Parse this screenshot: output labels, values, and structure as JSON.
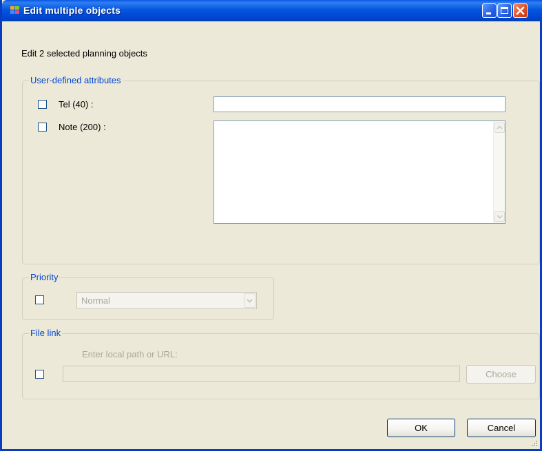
{
  "window": {
    "title": "Edit multiple objects",
    "subtitle": "Edit 2 selected planning objects"
  },
  "user_attributes": {
    "legend": "User-defined attributes",
    "tel_label": "Tel (40) :",
    "tel_value": "",
    "note_label": "Note (200) :",
    "note_value": ""
  },
  "priority": {
    "legend": "Priority",
    "selected": "Normal"
  },
  "file_link": {
    "legend": "File link",
    "hint": "Enter local path or URL:",
    "path_value": "",
    "choose_label": "Choose"
  },
  "buttons": {
    "ok": "OK",
    "cancel": "Cancel"
  },
  "colors": {
    "titlebar": "#0046d5",
    "legend_text": "#0046d5",
    "dialog_bg": "#ece9d8",
    "disabled_text": "#aca899"
  }
}
